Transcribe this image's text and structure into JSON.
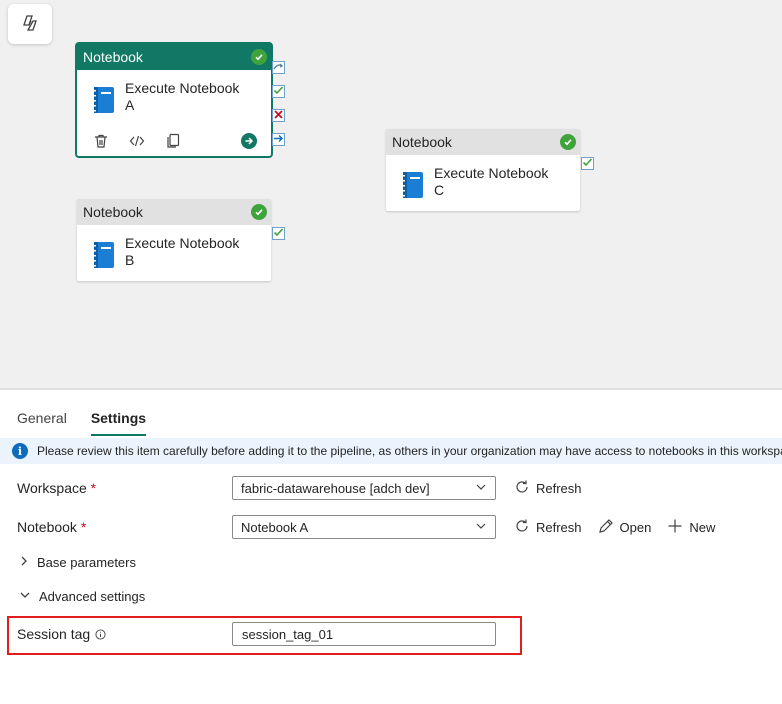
{
  "canvas": {
    "activities": [
      {
        "type": "Notebook",
        "name": "Execute Notebook A",
        "status": "succeeded",
        "selected": true
      },
      {
        "type": "Notebook",
        "name": "Execute Notebook B",
        "status": "succeeded",
        "selected": false
      },
      {
        "type": "Notebook",
        "name": "Execute Notebook C",
        "status": "succeeded",
        "selected": false
      }
    ]
  },
  "panel": {
    "tabs": [
      {
        "label": "General"
      },
      {
        "label": "Settings",
        "active": true
      }
    ],
    "info_message": "Please review this item carefully before adding it to the pipeline, as others in your organization may have access to notebooks in this workspace",
    "workspace": {
      "label": "Workspace",
      "required": "*",
      "value": "fabric-datawarehouse [adch dev]",
      "refresh_label": "Refresh"
    },
    "notebook": {
      "label": "Notebook",
      "required": "*",
      "value": "Notebook A",
      "refresh_label": "Refresh",
      "open_label": "Open",
      "new_label": "New"
    },
    "base_parameters": {
      "label": "Base parameters",
      "expanded": false
    },
    "advanced_settings": {
      "label": "Advanced settings",
      "expanded": true
    },
    "session_tag": {
      "label": "Session tag",
      "value": "session_tag_01"
    }
  },
  "colors": {
    "accent": "#117865",
    "success": "#3fa33b",
    "error": "#c50f1f",
    "info": "#0f6cbd",
    "highlight": "#e01e1e"
  }
}
